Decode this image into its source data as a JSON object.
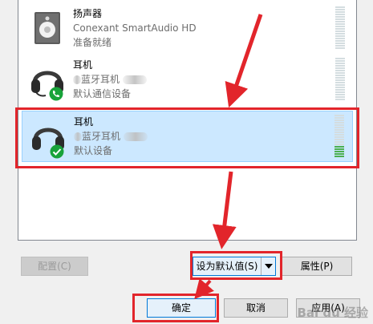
{
  "devices": [
    {
      "name": "扬声器",
      "desc": "Conexant SmartAudio HD",
      "status": "准备就绪",
      "icon": "speaker-icon"
    },
    {
      "name": "耳机",
      "desc": "蓝牙耳机",
      "status": "默认通信设备",
      "icon": "headset-icon",
      "badge": "phone-badge-icon"
    },
    {
      "name": "耳机",
      "desc": "蓝牙耳机",
      "status": "默认设备",
      "icon": "headset-icon",
      "badge": "check-badge-icon",
      "selected": true
    }
  ],
  "buttons": {
    "configure": "配置(C)",
    "set_default": "设为默认值(S)",
    "properties": "属性(P)",
    "ok": "确定",
    "cancel": "取消",
    "apply": "应用(A)"
  },
  "colors": {
    "selection_bg": "#cce8ff",
    "selection_border": "#99d1ff",
    "annotation_red": "#e2252b",
    "level_green": "#4caf50"
  },
  "watermark": "Bai du 经验"
}
